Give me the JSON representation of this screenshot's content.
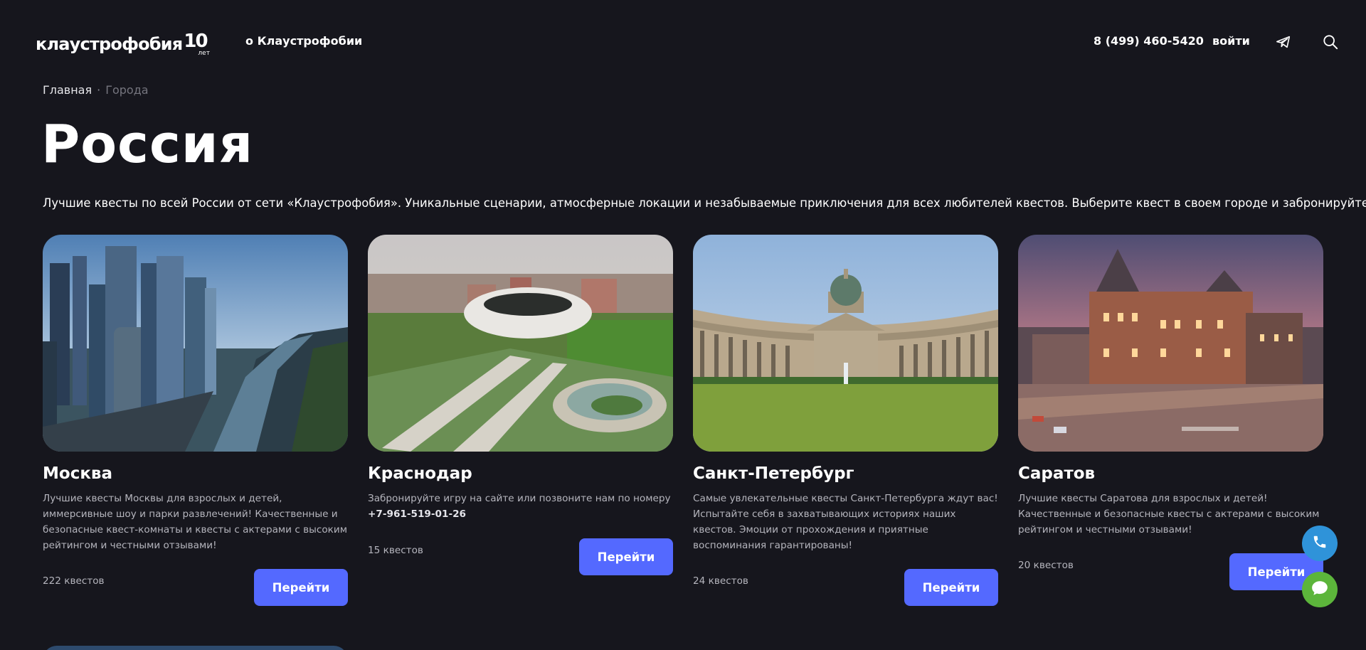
{
  "header": {
    "logo_text": "клаустрофобия",
    "logo_badge_num": "10",
    "logo_badge_sub": "лет",
    "nav_about": "о Клаустрофобии",
    "phone": "8 (499) 460-5420",
    "login": "войти",
    "telegram_icon": "telegram-icon",
    "search_icon": "search-icon"
  },
  "breadcrumb": {
    "home": "Главная",
    "separator": "·",
    "current": "Города"
  },
  "page": {
    "title": "Россия",
    "intro": "Лучшие квесты по всей России от сети «Клаустрофобия». Уникальные сценарии, атмосферные локации и незабываемые приключения для всех любителей квестов. Выберите квест в своем городе и забронируйте его!"
  },
  "cities": [
    {
      "name": "Москва",
      "description": "Лучшие квесты Москвы для взрослых и детей, иммерсивные шоу и парки развлечений! Качественные и безопасные квест-комнаты и квесты с актерами с высоким рейтингом и честными отзывами!",
      "phone_note": "",
      "count": "222 квестов",
      "button": "Перейти"
    },
    {
      "name": "Краснодар",
      "description": "Забронируйте игру на сайте или позвоните нам по номеру",
      "phone_note": "+7-961-519-01-26",
      "count": "15 квестов",
      "button": "Перейти"
    },
    {
      "name": "Санкт-Петербург",
      "description": "Самые увлекательные квесты Санкт-Петербурга ждут вас! Испытайте себя в захватывающих историях наших квестов. Эмоции от прохождения и приятные воспоминания гарантированы!",
      "phone_note": "",
      "count": "24 квестов",
      "button": "Перейти"
    },
    {
      "name": "Саратов",
      "description": "Лучшие квесты Саратова для взрослых и детей! Качественные и безопасные квесты с актерами с высоким рейтингом и честными отзывами!",
      "phone_note": "",
      "count": "20 квестов",
      "button": "Перейти"
    }
  ],
  "floating": {
    "phone_icon": "phone-icon",
    "chat_icon": "chat-icon"
  },
  "colors": {
    "background": "#16161d",
    "accent": "#5469ff",
    "fab_phone": "#2f93d9",
    "fab_chat": "#5cb53b"
  }
}
